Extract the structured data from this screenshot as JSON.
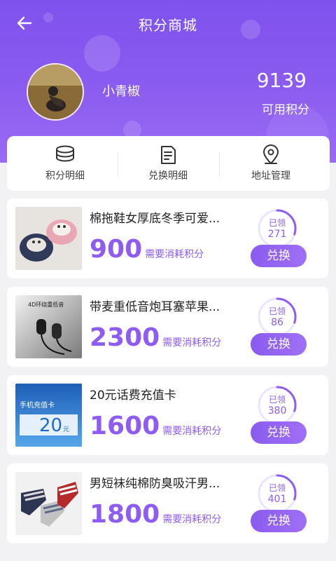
{
  "header": {
    "title": "积分商城",
    "back_icon": "arrow-left-icon"
  },
  "user": {
    "name": "小青椒",
    "points": "9139",
    "points_label": "可用积分"
  },
  "quick_links": [
    {
      "label": "积分明细",
      "icon": "coins-stack-icon"
    },
    {
      "label": "兑换明细",
      "icon": "document-icon"
    },
    {
      "label": "地址管理",
      "icon": "location-pin-icon"
    }
  ],
  "products": [
    {
      "name": "棉拖鞋女厚底冬季可爱...",
      "price": "900",
      "unit": "需要消耗积分",
      "claimed_label": "已领",
      "claimed": "271",
      "button": "兑换",
      "ring_fraction": 0.3
    },
    {
      "name": "带麦重低音炮耳塞苹果...",
      "price": "2300",
      "unit": "需要消耗积分",
      "claimed_label": "已领",
      "claimed": "86",
      "button": "兑换",
      "ring_fraction": 0.3,
      "image_text": "4D环绕重低音"
    },
    {
      "name": "20元话费充值卡",
      "price": "1600",
      "unit": "需要消耗积分",
      "claimed_label": "已领",
      "claimed": "380",
      "button": "兑换",
      "ring_fraction": 0.3,
      "image_text_1": "手机充值卡",
      "image_text_2": "20",
      "image_text_3": "元"
    },
    {
      "name": "男短袜纯棉防臭吸汗男...",
      "price": "1800",
      "unit": "需要消耗积分",
      "claimed_label": "已领",
      "claimed": "401",
      "button": "兑换",
      "ring_fraction": 0.3
    }
  ],
  "colors": {
    "accent": "#8e5cf2",
    "hero": "#8258ee"
  }
}
